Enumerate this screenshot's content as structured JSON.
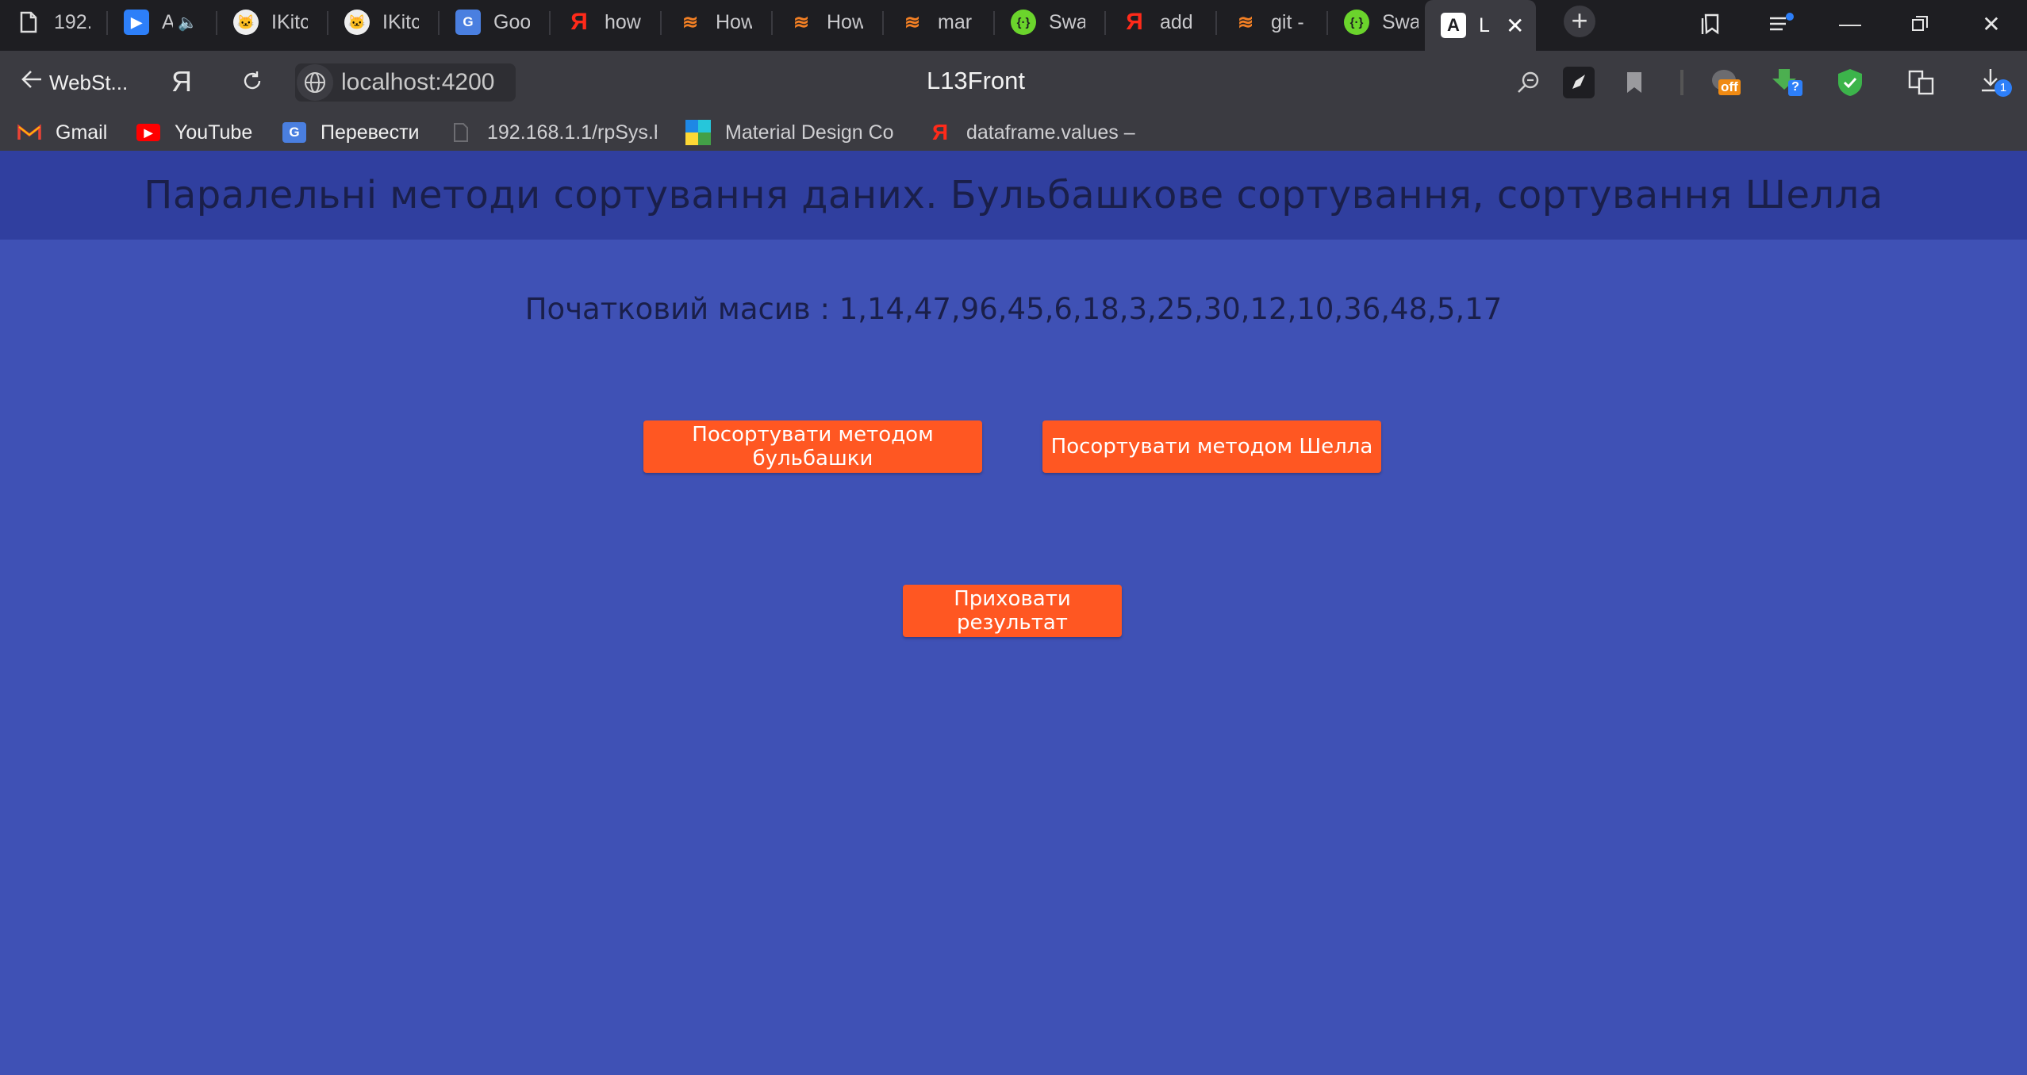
{
  "browser": {
    "tabs": [
      {
        "title": "192.",
        "icon": "page-icon"
      },
      {
        "title": "A",
        "icon": "video-player-icon",
        "audio": true
      },
      {
        "title": "IKitc",
        "icon": "github-icon"
      },
      {
        "title": "IKitc",
        "icon": "github-icon"
      },
      {
        "title": "Goo",
        "icon": "google-translate-icon"
      },
      {
        "title": "how",
        "icon": "yandex-icon"
      },
      {
        "title": "How",
        "icon": "stackoverflow-icon"
      },
      {
        "title": "How",
        "icon": "stackoverflow-icon"
      },
      {
        "title": "mar",
        "icon": "stackoverflow-icon"
      },
      {
        "title": "Swa",
        "icon": "swagger-icon"
      },
      {
        "title": "add",
        "icon": "yandex-icon"
      },
      {
        "title": "git -",
        "icon": "stackoverflow-icon"
      },
      {
        "title": "Swa",
        "icon": "swagger-icon"
      },
      {
        "title": "L",
        "icon": "angular-icon",
        "active": true
      }
    ],
    "back_label": "WebSt...",
    "url": "localhost:4200",
    "page_title": "L13Front",
    "extension_badge": "off",
    "extension_help_badge": "?",
    "downloads_count": "1",
    "bookmarks": [
      {
        "label": "Gmail",
        "icon": "gmail-icon"
      },
      {
        "label": "YouTube",
        "icon": "youtube-icon"
      },
      {
        "label": "Перевести",
        "icon": "google-translate-icon"
      },
      {
        "label": "192.168.1.1/rpSys.h",
        "icon": "page-icon"
      },
      {
        "label": "Material Design Co",
        "icon": "material-design-icon"
      },
      {
        "label": "dataframe.values –",
        "icon": "yandex-icon"
      }
    ]
  },
  "app": {
    "title": "Паралельні методи сортування даних. Бульбашкове сортування, сортування Шелла",
    "initial_array": "Початковий масив : 1,14,47,96,45,6,18,3,25,30,12,10,36,48,5,17",
    "buttons": {
      "bubble": "Посортувати методом бульбашки",
      "shell": "Посортувати методом Шелла",
      "hide": "Приховати результат"
    }
  },
  "colors": {
    "background": "#3f51b5",
    "header": "#303f9f",
    "accent": "#ff5722",
    "text_dark": "#1a1f4a"
  }
}
